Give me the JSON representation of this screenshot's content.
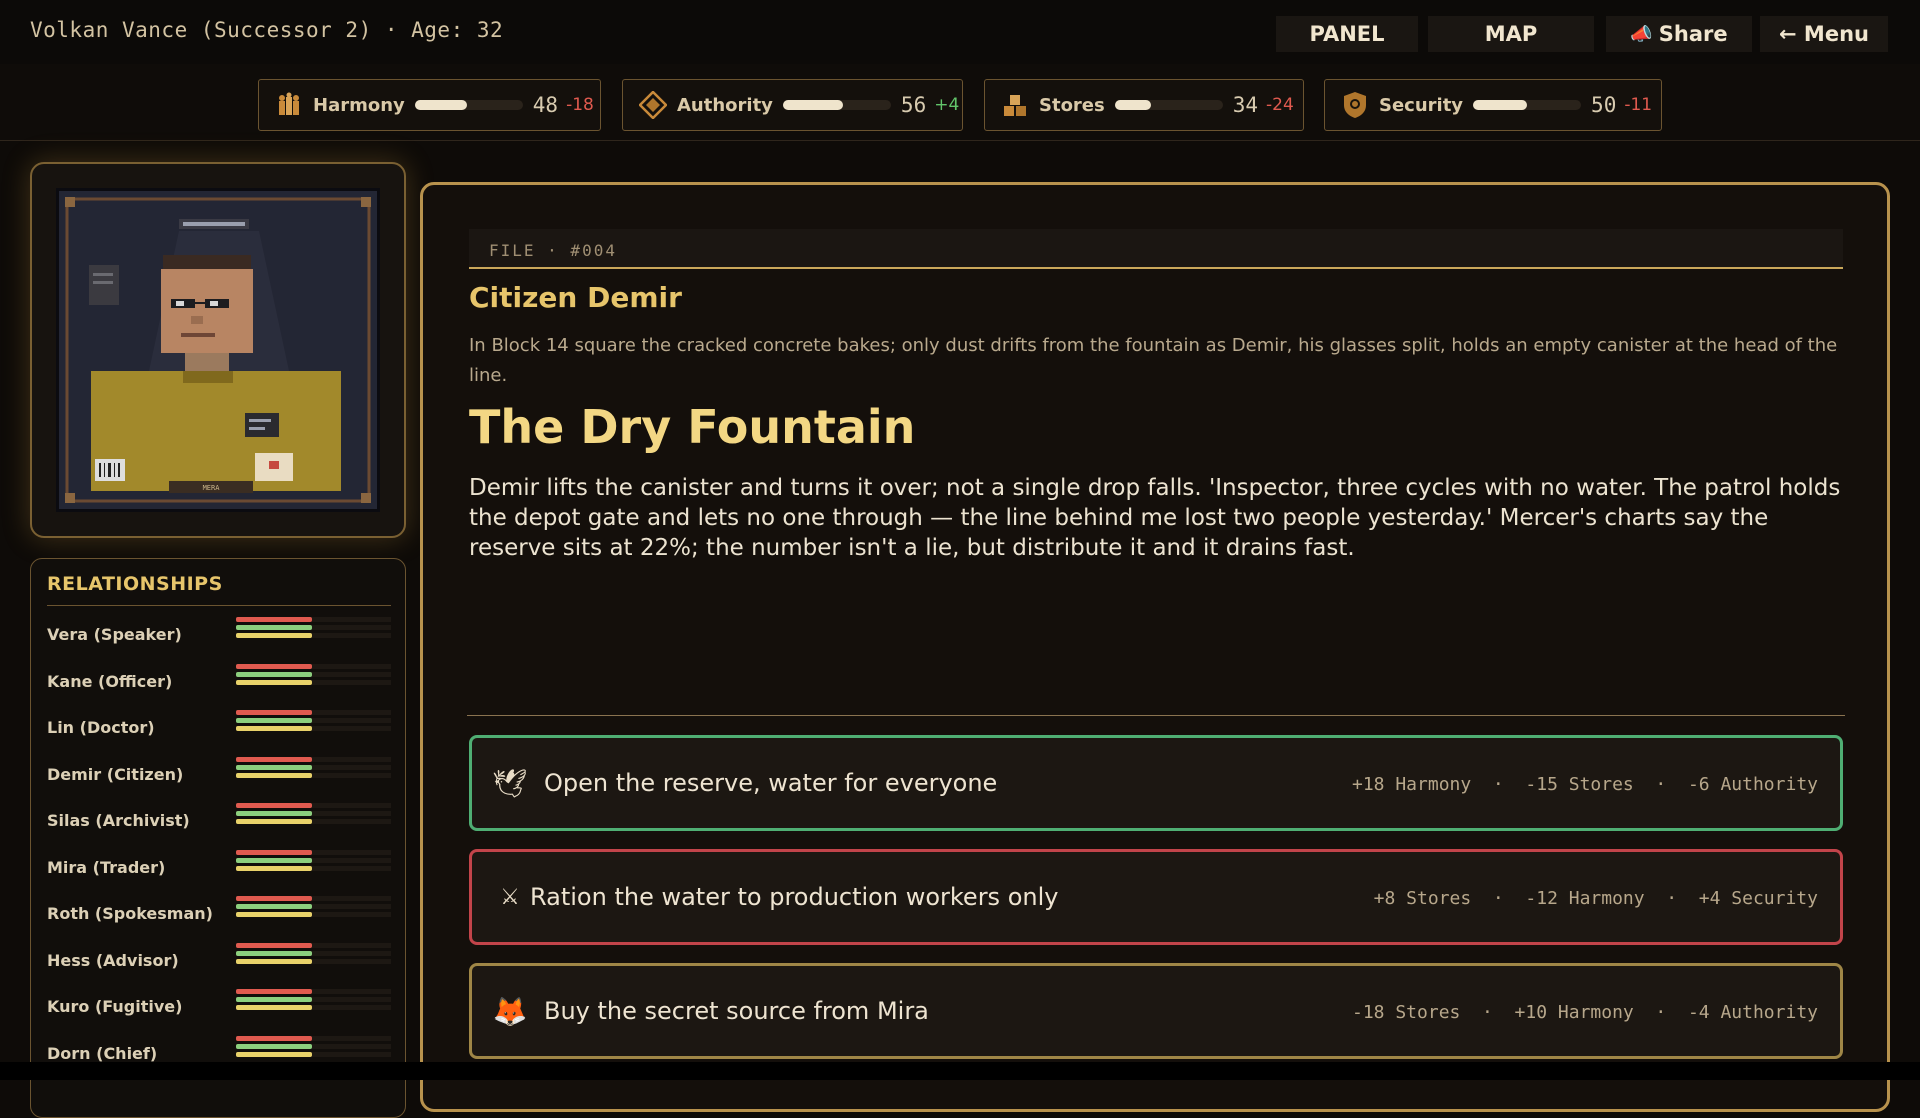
{
  "header": {
    "ruler": "Volkan Vance (Successor 2) · Age: 32",
    "buttons": [
      {
        "label": "PANEL"
      },
      {
        "label": "MAP"
      },
      {
        "label": "Share",
        "icon": "megaphone-icon"
      },
      {
        "label": "← Menu"
      }
    ]
  },
  "stats": [
    {
      "label": "Harmony",
      "value": "48",
      "delta": "-18",
      "icon": "people-icon",
      "fill_fraction": 0.48
    },
    {
      "label": "Authority",
      "value": "56",
      "delta": "+4",
      "icon": "diamond-icon",
      "fill_fraction": 0.56
    },
    {
      "label": "Stores",
      "value": "34",
      "delta": "-24",
      "icon": "crates-icon",
      "fill_fraction": 0.34
    },
    {
      "label": "Security",
      "value": "50",
      "delta": "-11",
      "icon": "shield-icon",
      "fill_fraction": 0.5
    }
  ],
  "portrait": {
    "name_plate": "MERA"
  },
  "relationships": {
    "title": "RELATIONSHIPS",
    "items": [
      {
        "name": "Vera (Speaker)"
      },
      {
        "name": "Kane (Officer)"
      },
      {
        "name": "Lin (Doctor)"
      },
      {
        "name": "Demir (Citizen)"
      },
      {
        "name": "Silas (Archivist)"
      },
      {
        "name": "Mira (Trader)"
      },
      {
        "name": "Roth (Spokesman)"
      },
      {
        "name": "Hess (Advisor)"
      },
      {
        "name": "Kuro (Fugitive)"
      },
      {
        "name": "Dorn (Chief)"
      }
    ],
    "bar_colors": [
      "#e05a4f",
      "#8ccf7e",
      "#e9d26a"
    ]
  },
  "event": {
    "file_tag": "FILE · #004",
    "speaker": "Citizen Demir",
    "scene": "In Block 14 square the cracked concrete bakes; only dust drifts from the fountain as Demir, his glasses split, holds an empty canister at the head of the line.",
    "title": "The Dry Fountain",
    "body": "Demir lifts the canister and turns it over; not a single drop falls. 'Inspector, three cycles with no water. The patrol holds the depot gate and lets no one through — the line behind me lost two people yesterday.' Mercer's charts say the reserve sits at 22%; the number isn't a lie, but distribute it and it drains fast.",
    "choices": [
      {
        "icon": "🕊",
        "icon_name": "dove-icon",
        "text": "Open the reserve, water for everyone",
        "effects": "+18 Harmony  ·  -15 Stores  ·  -6 Authority",
        "border": "#4fae73"
      },
      {
        "icon": "⚔",
        "icon_name": "swords-icon",
        "text": "Ration the water to production workers only",
        "effects": "+8 Stores  ·  -12 Harmony  ·  +4 Security",
        "border": "#c2444a"
      },
      {
        "icon": "🦊",
        "icon_name": "fox-icon",
        "text": "Buy the secret source from Mira",
        "effects": "-18 Stores  ·  +10 Harmony  ·  -4 Authority",
        "border": "#9f8646"
      }
    ]
  },
  "colors": {
    "accent": "#e7c56b",
    "frame": "#b8924d",
    "negative": "#e05a4f",
    "positive": "#62c46a"
  }
}
